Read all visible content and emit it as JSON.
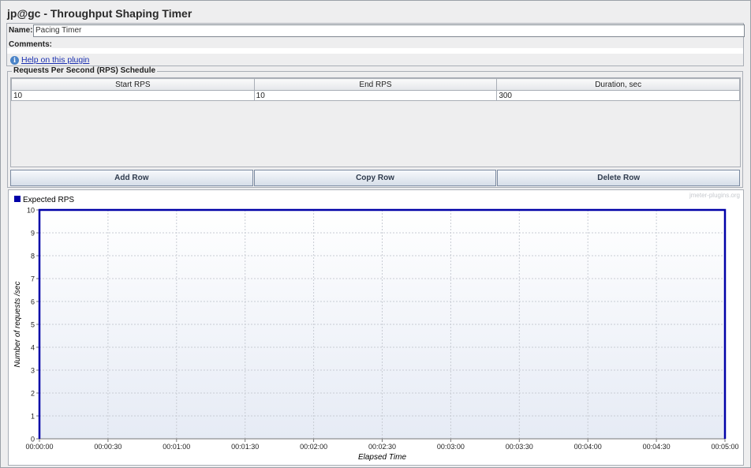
{
  "window": {
    "title": "jp@gc - Throughput Shaping Timer"
  },
  "form": {
    "name_label": "Name:",
    "name_value": "Pacing Timer",
    "comments_label": "Comments:",
    "help_link": "Help on this plugin"
  },
  "schedule": {
    "legend": "Requests Per Second (RPS) Schedule",
    "columns": [
      "Start RPS",
      "End RPS",
      "Duration, sec"
    ],
    "rows": [
      [
        "10",
        "10",
        "300"
      ]
    ]
  },
  "buttons": {
    "add": "Add Row",
    "copy": "Copy Row",
    "delete": "Delete Row"
  },
  "watermark": "jmeter-plugins.org",
  "colors": {
    "series": "#0000a8",
    "grid": "#c8ccd4"
  },
  "chart_data": {
    "type": "line",
    "series": [
      {
        "name": "Expected RPS",
        "x": [
          "00:00:00",
          "00:00:00",
          "00:05:00",
          "00:05:00"
        ],
        "y": [
          0,
          10,
          10,
          0
        ]
      }
    ],
    "xlabel": "Elapsed Time",
    "ylabel": "Number of requests /sec",
    "x_ticks": [
      "00:00:00",
      "00:00:30",
      "00:01:00",
      "00:01:30",
      "00:02:00",
      "00:02:30",
      "00:03:00",
      "00:03:30",
      "00:04:00",
      "00:04:30",
      "00:05:00"
    ],
    "x_range_seconds": [
      0,
      300
    ],
    "y_ticks": [
      "0",
      "1",
      "2",
      "3",
      "4",
      "5",
      "6",
      "7",
      "8",
      "9",
      "10"
    ],
    "ylim": [
      0,
      10
    ],
    "grid": true,
    "legend": "top-left"
  }
}
